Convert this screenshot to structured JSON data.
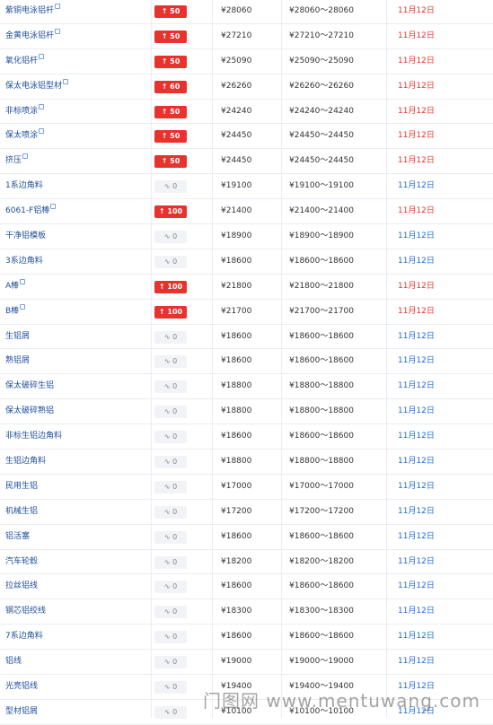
{
  "rows": [
    {
      "name": "紫铜电泳铝杆",
      "edit": true,
      "change": "↑ 50",
      "trend": "up",
      "avg": "¥28060",
      "range": "¥28060～28060",
      "date": "11月12日"
    },
    {
      "name": "金黄电泳铝杆",
      "edit": true,
      "change": "↑ 50",
      "trend": "up",
      "avg": "¥27210",
      "range": "¥27210～27210",
      "date": "11月12日"
    },
    {
      "name": "氧化铝杆",
      "edit": true,
      "change": "↑ 50",
      "trend": "up",
      "avg": "¥25090",
      "range": "¥25090～25090",
      "date": "11月12日"
    },
    {
      "name": "保太电泳铝型材",
      "edit": true,
      "change": "↑ 60",
      "trend": "up",
      "avg": "¥26260",
      "range": "¥26260～26260",
      "date": "11月12日"
    },
    {
      "name": "非标喷涂",
      "edit": true,
      "change": "↑ 50",
      "trend": "up",
      "avg": "¥24240",
      "range": "¥24240～24240",
      "date": "11月12日"
    },
    {
      "name": "保太喷涂",
      "edit": true,
      "change": "↑ 50",
      "trend": "up",
      "avg": "¥24450",
      "range": "¥24450～24450",
      "date": "11月12日"
    },
    {
      "name": "挤压",
      "edit": true,
      "change": "↑ 50",
      "trend": "up",
      "avg": "¥24450",
      "range": "¥24450～24450",
      "date": "11月12日"
    },
    {
      "name": "1系边角料",
      "edit": false,
      "change": "∿ 0",
      "trend": "flat",
      "avg": "¥19100",
      "range": "¥19100～19100",
      "date": "11月12日"
    },
    {
      "name": "6061-F铝棒",
      "edit": true,
      "change": "↑ 100",
      "trend": "up",
      "avg": "¥21400",
      "range": "¥21400～21400",
      "date": "11月12日"
    },
    {
      "name": "干净铝模板",
      "edit": false,
      "change": "∿ 0",
      "trend": "flat",
      "avg": "¥18900",
      "range": "¥18900～18900",
      "date": "11月12日"
    },
    {
      "name": "3系边角料",
      "edit": false,
      "change": "∿ 0",
      "trend": "flat",
      "avg": "¥18600",
      "range": "¥18600～18600",
      "date": "11月12日"
    },
    {
      "name": "A棒",
      "edit": true,
      "change": "↑ 100",
      "trend": "up",
      "avg": "¥21800",
      "range": "¥21800～21800",
      "date": "11月12日"
    },
    {
      "name": "B棒",
      "edit": true,
      "change": "↑ 100",
      "trend": "up",
      "avg": "¥21700",
      "range": "¥21700～21700",
      "date": "11月12日"
    },
    {
      "name": "生铝屑",
      "edit": false,
      "change": "∿ 0",
      "trend": "flat",
      "avg": "¥18600",
      "range": "¥18600～18600",
      "date": "11月12日"
    },
    {
      "name": "熟铝屑",
      "edit": false,
      "change": "∿ 0",
      "trend": "flat",
      "avg": "¥18600",
      "range": "¥18600～18600",
      "date": "11月12日"
    },
    {
      "name": "保太破碎生铝",
      "edit": false,
      "change": "∿ 0",
      "trend": "flat",
      "avg": "¥18800",
      "range": "¥18800～18800",
      "date": "11月12日"
    },
    {
      "name": "保太破碎熟铝",
      "edit": false,
      "change": "∿ 0",
      "trend": "flat",
      "avg": "¥18800",
      "range": "¥18800～18800",
      "date": "11月12日"
    },
    {
      "name": "非标生铝边角料",
      "edit": false,
      "change": "∿ 0",
      "trend": "flat",
      "avg": "¥18600",
      "range": "¥18600～18600",
      "date": "11月12日"
    },
    {
      "name": "生铝边角料",
      "edit": false,
      "change": "∿ 0",
      "trend": "flat",
      "avg": "¥18800",
      "range": "¥18800～18800",
      "date": "11月12日"
    },
    {
      "name": "民用生铝",
      "edit": false,
      "change": "∿ 0",
      "trend": "flat",
      "avg": "¥17000",
      "range": "¥17000～17000",
      "date": "11月12日"
    },
    {
      "name": "机械生铝",
      "edit": false,
      "change": "∿ 0",
      "trend": "flat",
      "avg": "¥17200",
      "range": "¥17200～17200",
      "date": "11月12日"
    },
    {
      "name": "铝活塞",
      "edit": false,
      "change": "∿ 0",
      "trend": "flat",
      "avg": "¥18600",
      "range": "¥18600～18600",
      "date": "11月12日"
    },
    {
      "name": "汽车轮毂",
      "edit": false,
      "change": "∿ 0",
      "trend": "flat",
      "avg": "¥18200",
      "range": "¥18200～18200",
      "date": "11月12日"
    },
    {
      "name": "拉丝铝线",
      "edit": false,
      "change": "∿ 0",
      "trend": "flat",
      "avg": "¥18600",
      "range": "¥18600～18600",
      "date": "11月12日"
    },
    {
      "name": "钢芯铝绞线",
      "edit": false,
      "change": "∿ 0",
      "trend": "flat",
      "avg": "¥18300",
      "range": "¥18300～18300",
      "date": "11月12日"
    },
    {
      "name": "7系边角料",
      "edit": false,
      "change": "∿ 0",
      "trend": "flat",
      "avg": "¥18600",
      "range": "¥18600～18600",
      "date": "11月12日"
    },
    {
      "name": "铝线",
      "edit": false,
      "change": "∿ 0",
      "trend": "flat",
      "avg": "¥19000",
      "range": "¥19000～19000",
      "date": "11月12日"
    },
    {
      "name": "光亮铝线",
      "edit": false,
      "change": "∿ 0",
      "trend": "flat",
      "avg": "¥19400",
      "range": "¥19400～19400",
      "date": "11月12日"
    },
    {
      "name": "型材铝屑",
      "edit": false,
      "change": "∿ 0",
      "trend": "flat",
      "avg": "¥10100",
      "range": "¥10100～10100",
      "date": "11月12日"
    }
  ],
  "watermark": "门图网 www.mentuwang.com",
  "colors": {
    "up": "#e8322e",
    "flat_text": "#1f6ad4",
    "link": "#1f4e9a"
  }
}
